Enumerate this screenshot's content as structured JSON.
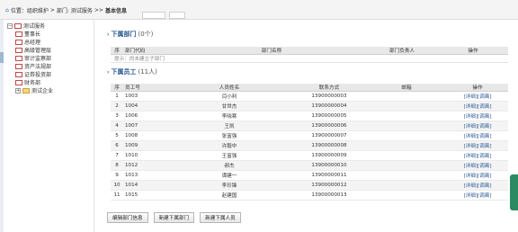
{
  "breadcrumb": {
    "home_label": "位置：组织维护",
    "sep1": ">",
    "dept_label": "部门:",
    "company_label": "测试服务",
    "sep2": ">>",
    "current_label": "基本信息"
  },
  "tree": {
    "root": "测试服务",
    "children": [
      "董事长",
      "总经理",
      "高级管理层",
      "审计监察部",
      "资产法规部",
      "证券投资部",
      "财务部"
    ],
    "sibling": "测试企业"
  },
  "subdepts": {
    "title": "下属部门",
    "count": "(0个)",
    "columns": [
      "序",
      "部门代码",
      "部门名称",
      "部门负责人",
      "操作"
    ],
    "empty_hint": "提示：尚未建立子部门"
  },
  "staff": {
    "title": "下属员工",
    "count": "(11人)",
    "columns": [
      "序",
      "员工号",
      "人员姓名",
      "联系方式",
      "邮箱",
      "操作"
    ],
    "rows": [
      {
        "no": "1",
        "id": "1003",
        "name": "闫小利",
        "phone": "13900000003",
        "email": "",
        "op_detail": "[详细]",
        "op_move": "[调离]"
      },
      {
        "no": "2",
        "id": "1004",
        "name": "甘世杰",
        "phone": "13900000004",
        "email": "",
        "op_detail": "[详细]",
        "op_move": "[调离]"
      },
      {
        "no": "3",
        "id": "1006",
        "name": "李晓寒",
        "phone": "13900000005",
        "email": "",
        "op_detail": "[详细]",
        "op_move": "[调离]"
      },
      {
        "no": "4",
        "id": "1007",
        "name": "王凯",
        "phone": "13900000006",
        "email": "",
        "op_detail": "[详细]",
        "op_move": "[调离]"
      },
      {
        "no": "5",
        "id": "1008",
        "name": "张富强",
        "phone": "13900000007",
        "email": "",
        "op_detail": "[详细]",
        "op_move": "[调离]"
      },
      {
        "no": "6",
        "id": "1009",
        "name": "许毅中",
        "phone": "13900000008",
        "email": "",
        "op_detail": "[详细]",
        "op_move": "[调离]"
      },
      {
        "no": "7",
        "id": "1010",
        "name": "王富强",
        "phone": "13900000009",
        "email": "",
        "op_detail": "[详细]",
        "op_move": "[调离]"
      },
      {
        "no": "8",
        "id": "1012",
        "name": "郝杰",
        "phone": "13900000010",
        "email": "",
        "op_detail": "[详细]",
        "op_move": "[调离]"
      },
      {
        "no": "9",
        "id": "1013",
        "name": "谭建一",
        "phone": "13900000011",
        "email": "",
        "op_detail": "[详细]",
        "op_move": "[调离]"
      },
      {
        "no": "10",
        "id": "1014",
        "name": "李珍锋",
        "phone": "13900000012",
        "email": "",
        "op_detail": "[详细]",
        "op_move": "[调离]"
      },
      {
        "no": "11",
        "id": "1015",
        "name": "赵建国",
        "phone": "13900000013",
        "email": "",
        "op_detail": "[详细]",
        "op_move": "[调离]"
      }
    ]
  },
  "buttons": {
    "edit": "编辑部门信息",
    "new_dept": "新建下属部门",
    "new_staff": "新建下属人员"
  },
  "colors": {
    "accent": "#2b5a93",
    "scroll_handle": "#2c8a63"
  }
}
